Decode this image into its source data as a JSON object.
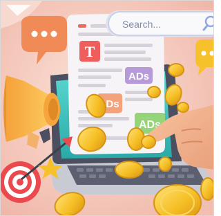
{
  "search": {
    "placeholder": "Search..."
  },
  "ads": {
    "badge_top": "ADs",
    "badge_middle": "Ds",
    "badge_bottom": "ADs"
  },
  "page_icon": {
    "letter": "T"
  },
  "icons": [
    "search-icon",
    "speech-bubble-icon",
    "megaphone-icon",
    "target-icon",
    "dart-icon",
    "star-icon",
    "coin-icon",
    "pointing-hand-icon",
    "laptop-icon"
  ],
  "colors": {
    "background": "#f6d0c4",
    "web_page": "#f7f4f7",
    "ad_purple": "#b79ad9",
    "ad_orange": "#f3a27b",
    "ad_green": "#96d47a",
    "speech_bubble": "#f08a57",
    "coin": "#f6bf25",
    "laptop": "#5b5f70",
    "screen": "#38c3bd",
    "search_bar": "#f9f9fb",
    "target_red": "#ea4a4d"
  }
}
